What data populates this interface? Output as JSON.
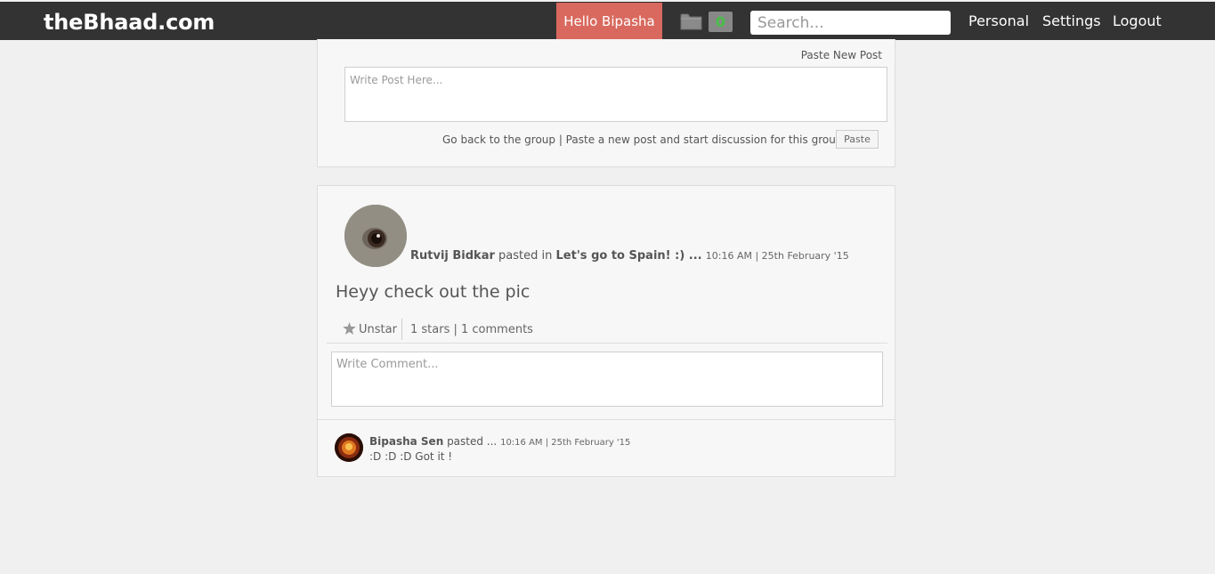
{
  "header": {
    "brand": "theBhaad.com",
    "greeting": "Hello Bipasha",
    "notifications_count": "0",
    "search_placeholder": "Search...",
    "nav": {
      "personal": "Personal",
      "settings": "Settings",
      "logout": "Logout"
    },
    "colors": {
      "bar": "#333333",
      "greeting_bg": "#d9695e",
      "count_text": "#48c048"
    }
  },
  "new_post": {
    "label": "Paste New Post",
    "placeholder": "Write Post Here...",
    "hint": "Go back to the group | Paste a new post and start discussion for this group!",
    "button": "Paste"
  },
  "post": {
    "author": "Rutvij Bidkar",
    "verb": "pasted in",
    "group": "Let's go to Spain! :) ...",
    "time": "10:16 AM | 25th February '15",
    "body": "Heyy check out the pic",
    "star_icon": "star-icon",
    "unstar_label": "Unstar",
    "stats": "1 stars | 1 comments",
    "comment_placeholder": "Write Comment..."
  },
  "comment": {
    "author": "Bipasha Sen",
    "verb": "pasted ...",
    "time": "10:16 AM | 25th February '15",
    "text": ":D :D :D Got it !"
  }
}
